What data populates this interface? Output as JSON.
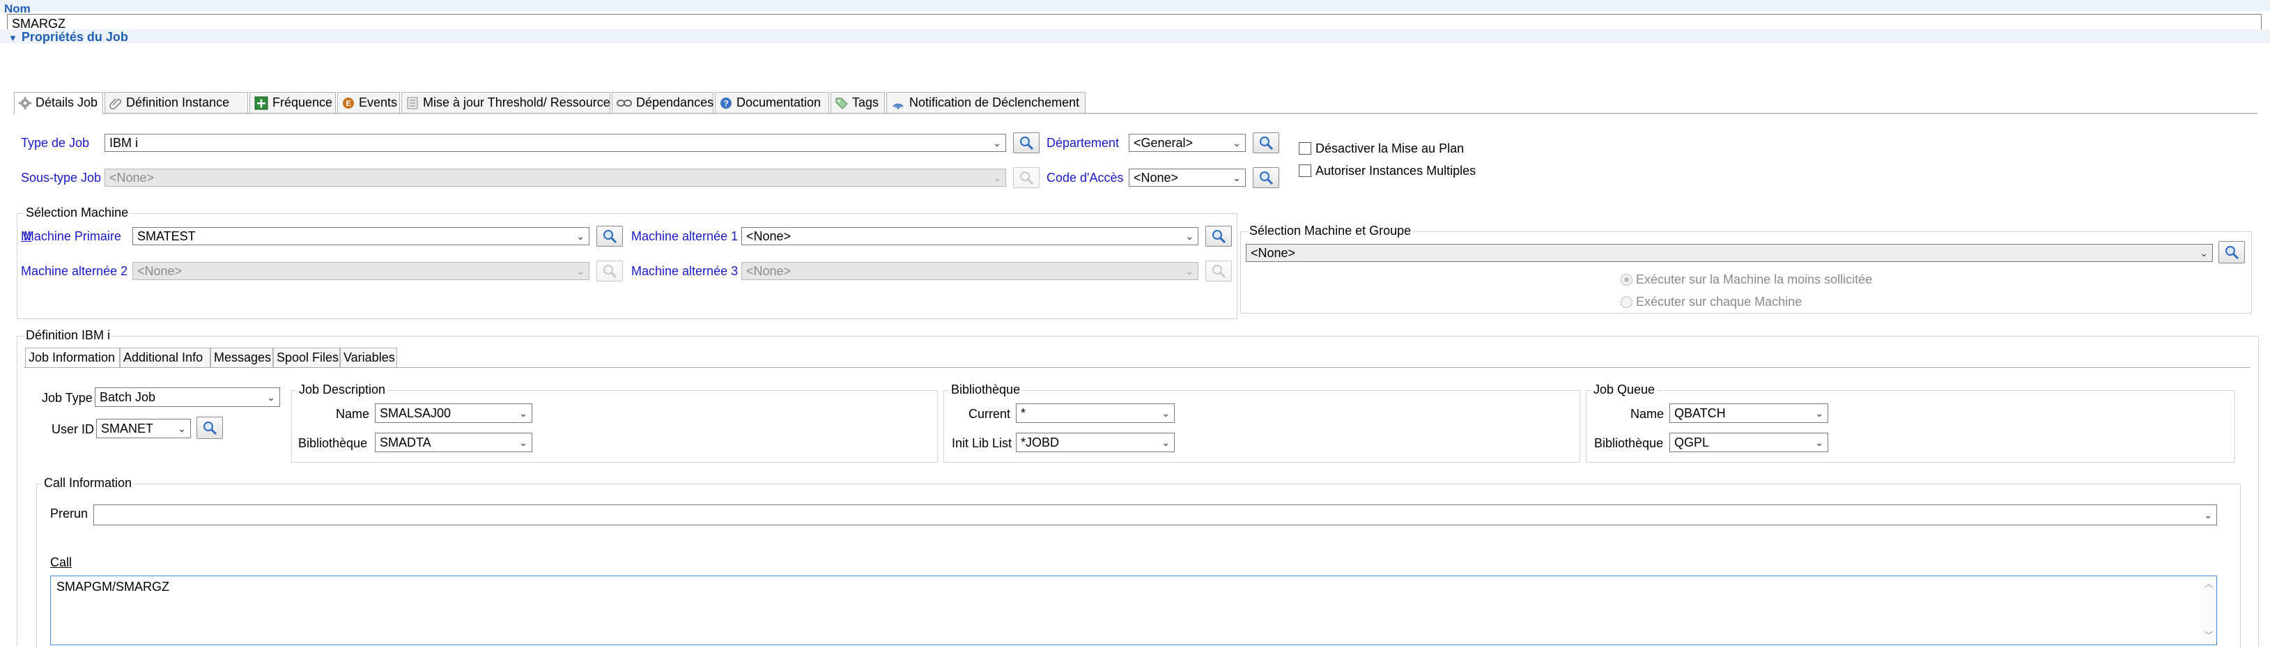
{
  "nom": {
    "label": "Nom",
    "value": "SMARGZ"
  },
  "section_proprietes": {
    "title": "Propriétés du Job"
  },
  "tabs": [
    {
      "label": "Détails Job",
      "icon": "gear-icon"
    },
    {
      "label": "Définition Instance",
      "icon": "paperclip-icon"
    },
    {
      "label": "Fréquence",
      "icon": "calendar-plus-icon"
    },
    {
      "label": "Events",
      "icon": "event-icon"
    },
    {
      "label": "Mise à jour Threshold/ Ressource",
      "icon": "resource-icon"
    },
    {
      "label": "Dépendances",
      "icon": "link-icon"
    },
    {
      "label": "Documentation",
      "icon": "help-icon"
    },
    {
      "label": "Tags",
      "icon": "tag-icon"
    },
    {
      "label": "Notification de Déclenchement",
      "icon": "signal-icon"
    }
  ],
  "job": {
    "type_label": "Type de Job",
    "type_value": "IBM i",
    "soustype_label": "Sous-type Job",
    "soustype_value": "<None>",
    "departement_label": "Département",
    "departement_value": "<General>",
    "code_acces_label": "Code d'Accès",
    "code_acces_value": "<None>",
    "desactiver_label": "Désactiver la Mise au Plan",
    "autoriser_label": "Autoriser Instances Multiples"
  },
  "selection_machine": {
    "title": "Sélection Machine",
    "primaire_label": "Machine Primaire",
    "primaire_value": "SMATEST",
    "alt1_label": "Machine alternée 1",
    "alt1_value": "<None>",
    "alt2_label": "Machine alternée 2",
    "alt2_value": "<None>",
    "alt3_label": "Machine alternée 3",
    "alt3_value": "<None>"
  },
  "selection_groupe": {
    "title": "Sélection Machine et Groupe",
    "value": "<None>",
    "radio1": "Exécuter sur la Machine la moins sollicitée",
    "radio2": "Exécuter sur chaque Machine"
  },
  "ibmi": {
    "title": "Définition IBM i",
    "subtabs": [
      "Job Information",
      "Additional Info",
      "Messages",
      "Spool Files",
      "Variables"
    ],
    "job_type_label": "Job Type",
    "job_type_value": "Batch Job",
    "user_id_label": "User ID",
    "user_id_value": "SMANET",
    "job_desc": {
      "title": "Job Description",
      "name_label": "Name",
      "name_value": "SMALSAJ00",
      "bib_label": "Bibliothèque",
      "bib_value": "SMADTA"
    },
    "bibliotheque": {
      "title": "Bibliothèque",
      "current_label": "Current",
      "current_value": "*",
      "initlib_label": "Init Lib List",
      "initlib_value": "*JOBD"
    },
    "job_queue": {
      "title": "Job Queue",
      "name_label": "Name",
      "name_value": "QBATCH",
      "bib_label": "Bibliothèque",
      "bib_value": "QGPL"
    },
    "call_info": {
      "title": "Call Information",
      "prerun_label": "Prerun",
      "prerun_value": "",
      "call_label": "Call",
      "call_value": "SMAPGM/SMARGZ"
    }
  }
}
